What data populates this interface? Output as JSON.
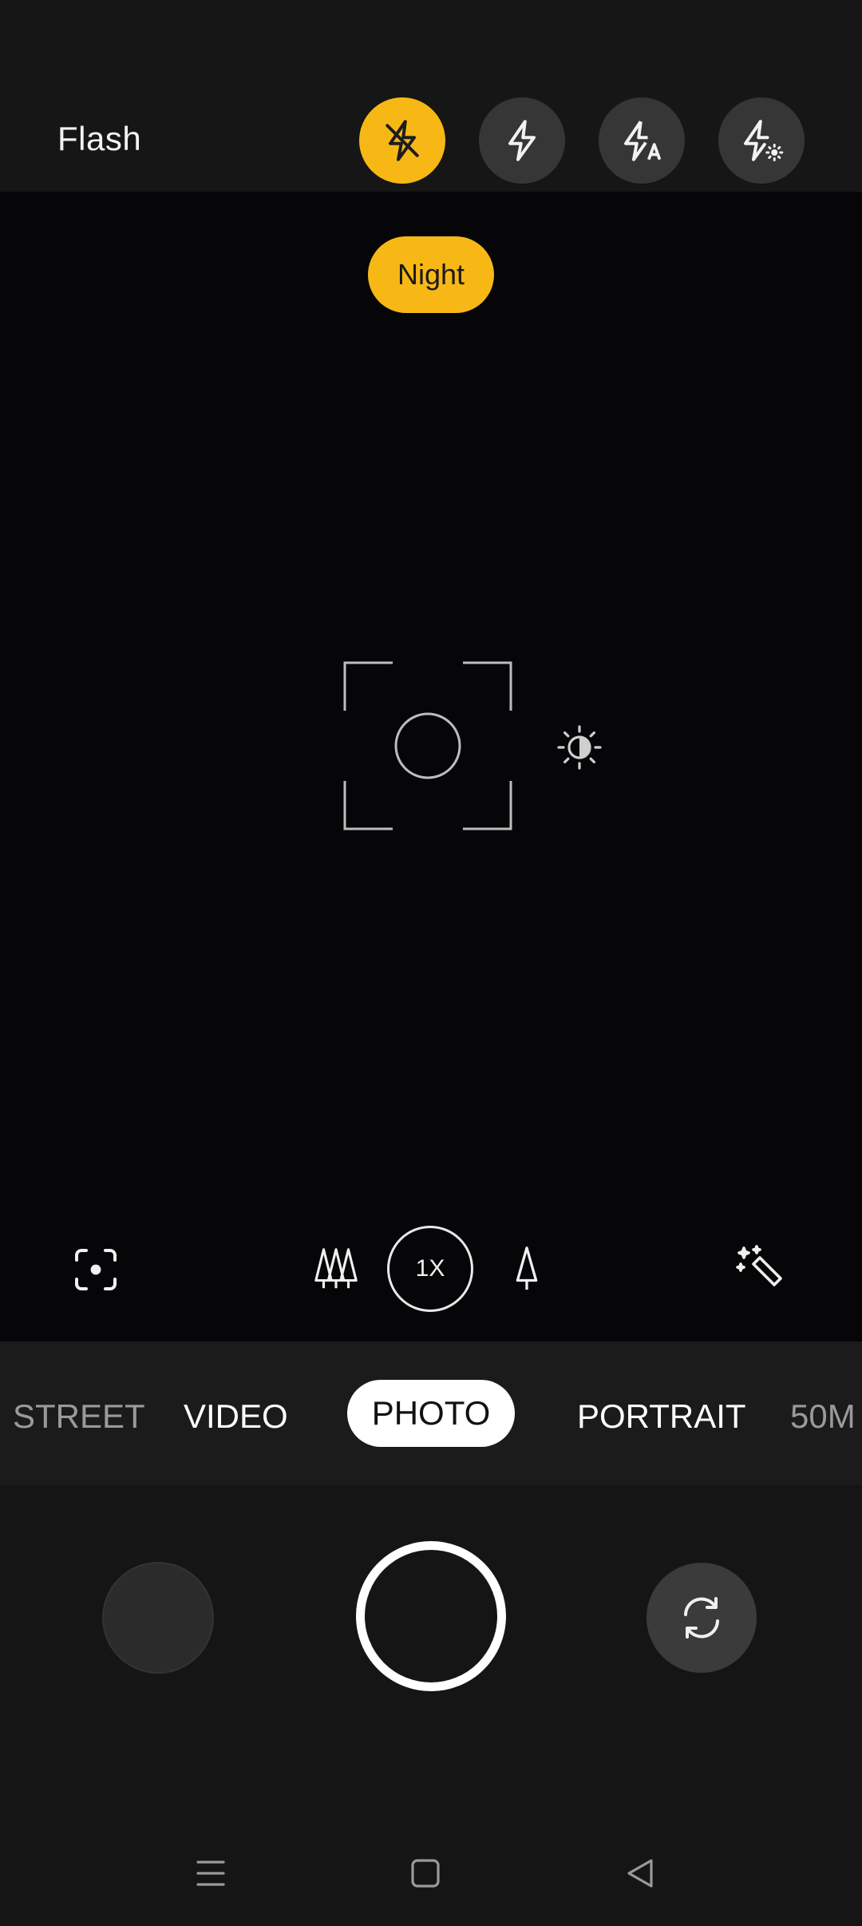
{
  "flash": {
    "label": "Flash",
    "options": [
      {
        "icon": "flash-off-icon",
        "selected": true
      },
      {
        "icon": "flash-on-icon",
        "selected": false
      },
      {
        "icon": "flash-auto-icon",
        "selected": false
      },
      {
        "icon": "flash-torch-icon",
        "selected": false
      }
    ],
    "active_color": "#f7b816"
  },
  "viewfinder": {
    "night_badge": "Night",
    "focus_icon": "focus-frame-icon",
    "exposure_icon": "exposure-icon"
  },
  "tools": {
    "left_icon": "scan-lens-icon",
    "wide_icon": "ultra-wide-trees-icon",
    "zoom_label": "1X",
    "tele_icon": "single-tree-icon",
    "magic_icon": "magic-wand-icon"
  },
  "modes": {
    "items": [
      "STREET",
      "VIDEO",
      "PHOTO",
      "PORTRAIT",
      "50M"
    ],
    "selected": "PHOTO"
  },
  "controls": {
    "gallery_icon": "gallery-thumbnail",
    "shutter_icon": "shutter-button",
    "switch_icon": "switch-camera-icon"
  },
  "navbar": {
    "items": [
      "menu-icon",
      "home-icon",
      "back-icon"
    ]
  }
}
